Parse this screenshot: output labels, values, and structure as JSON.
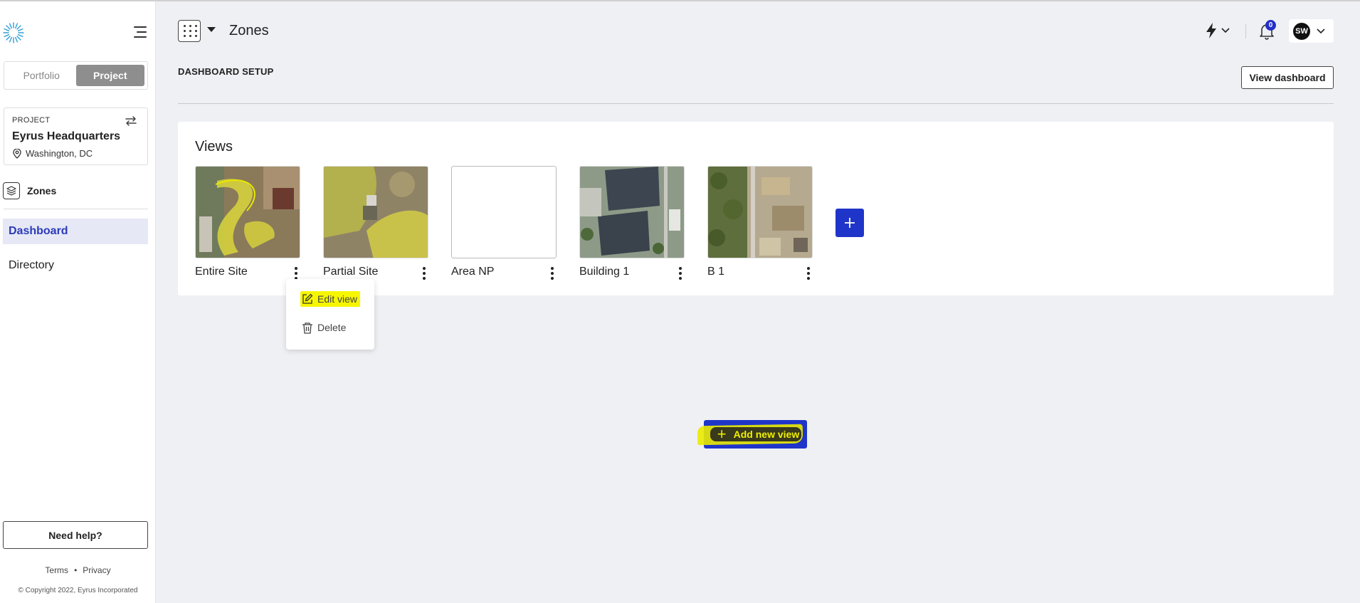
{
  "sidebar": {
    "toggle": {
      "portfolio": "Portfolio",
      "project": "Project"
    },
    "project_card": {
      "label": "PROJECT",
      "name": "Eyrus Headquarters",
      "location": "Washington, DC"
    },
    "zones_link": "Zones",
    "nav": [
      {
        "label": "Dashboard",
        "active": true
      },
      {
        "label": "Directory",
        "active": false
      }
    ],
    "help": "Need help?",
    "footer": {
      "terms": "Terms",
      "separator": "•",
      "privacy": "Privacy",
      "copyright": "© Copyright 2022, Eyrus Incorporated"
    }
  },
  "topbar": {
    "title": "Zones",
    "notifications_count": "0",
    "user_initials": "SW"
  },
  "main": {
    "section_title": "DASHBOARD SETUP",
    "view_dashboard": "View dashboard",
    "views_title": "Views",
    "views": [
      {
        "label": "Entire Site",
        "thumb": "aerial-site-highlighted"
      },
      {
        "label": "Partial Site",
        "thumb": "aerial-partial-highlighted"
      },
      {
        "label": "Area NP",
        "thumb": "blank"
      },
      {
        "label": "Building 1",
        "thumb": "aerial-building"
      },
      {
        "label": "B 1",
        "thumb": "aerial-construction"
      }
    ],
    "dropdown": {
      "edit": "Edit view",
      "delete": "Delete"
    },
    "add_new_view": "Add new view"
  },
  "colors": {
    "accent": "#1f35c9",
    "active_nav_bg": "#e6e8f6",
    "active_nav_text": "#2b3ab8",
    "highlight": "#f6f600"
  }
}
